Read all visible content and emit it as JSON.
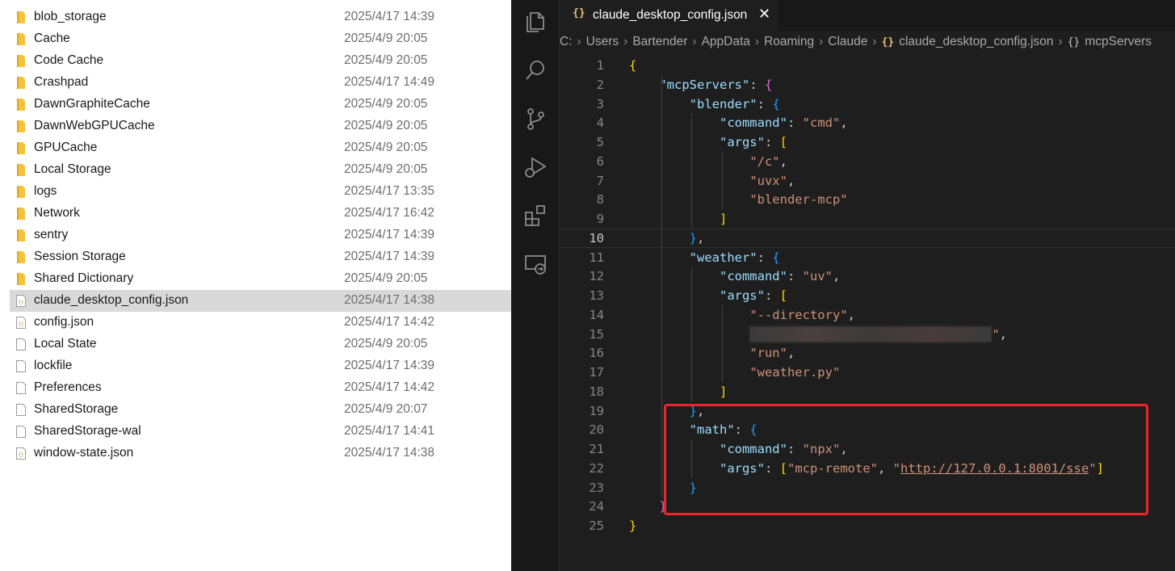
{
  "explorer": {
    "files": [
      {
        "name": "blob_storage",
        "date": "2025/4/17 14:39",
        "type": "folder"
      },
      {
        "name": "Cache",
        "date": "2025/4/9 20:05",
        "type": "folder"
      },
      {
        "name": "Code Cache",
        "date": "2025/4/9 20:05",
        "type": "folder"
      },
      {
        "name": "Crashpad",
        "date": "2025/4/17 14:49",
        "type": "folder"
      },
      {
        "name": "DawnGraphiteCache",
        "date": "2025/4/9 20:05",
        "type": "folder"
      },
      {
        "name": "DawnWebGPUCache",
        "date": "2025/4/9 20:05",
        "type": "folder"
      },
      {
        "name": "GPUCache",
        "date": "2025/4/9 20:05",
        "type": "folder"
      },
      {
        "name": "Local Storage",
        "date": "2025/4/9 20:05",
        "type": "folder"
      },
      {
        "name": "logs",
        "date": "2025/4/17 13:35",
        "type": "folder"
      },
      {
        "name": "Network",
        "date": "2025/4/17 16:42",
        "type": "folder"
      },
      {
        "name": "sentry",
        "date": "2025/4/17 14:39",
        "type": "folder"
      },
      {
        "name": "Session Storage",
        "date": "2025/4/17 14:39",
        "type": "folder"
      },
      {
        "name": "Shared Dictionary",
        "date": "2025/4/9 20:05",
        "type": "folder"
      },
      {
        "name": "claude_desktop_config.json",
        "date": "2025/4/17 14:38",
        "type": "json",
        "selected": true
      },
      {
        "name": "config.json",
        "date": "2025/4/17 14:42",
        "type": "json"
      },
      {
        "name": "Local State",
        "date": "2025/4/9 20:05",
        "type": "file"
      },
      {
        "name": "lockfile",
        "date": "2025/4/17 14:39",
        "type": "file"
      },
      {
        "name": "Preferences",
        "date": "2025/4/17 14:42",
        "type": "file"
      },
      {
        "name": "SharedStorage",
        "date": "2025/4/9 20:07",
        "type": "file"
      },
      {
        "name": "SharedStorage-wal",
        "date": "2025/4/17 14:41",
        "type": "file"
      },
      {
        "name": "window-state.json",
        "date": "2025/4/17 14:38",
        "type": "json"
      }
    ]
  },
  "editor": {
    "tab": {
      "icon_text": "{}",
      "label": "claude_desktop_config.json",
      "close": "✕"
    },
    "breadcrumb": [
      "C:",
      "Users",
      "Bartender",
      "AppData",
      "Roaming",
      "Claude"
    ],
    "breadcrumb_file": "claude_desktop_config.json",
    "breadcrumb_json_icon": "{}",
    "breadcrumb_symbol_icon": "{}",
    "breadcrumb_symbol": "mcpServers",
    "active_line": 10,
    "lines": [
      [
        [
          "b1",
          "{"
        ]
      ],
      [
        [
          "i",
          "    "
        ],
        [
          "k",
          "\"mcpServers\""
        ],
        [
          "p",
          ": "
        ],
        [
          "b2",
          "{"
        ]
      ],
      [
        [
          "i",
          "        "
        ],
        [
          "k",
          "\"blender\""
        ],
        [
          "p",
          ": "
        ],
        [
          "b3",
          "{"
        ]
      ],
      [
        [
          "i",
          "            "
        ],
        [
          "k",
          "\"command\""
        ],
        [
          "p",
          ": "
        ],
        [
          "s",
          "\"cmd\""
        ],
        [
          "p",
          ","
        ]
      ],
      [
        [
          "i",
          "            "
        ],
        [
          "k",
          "\"args\""
        ],
        [
          "p",
          ": "
        ],
        [
          "b1",
          "["
        ]
      ],
      [
        [
          "i",
          "                "
        ],
        [
          "s",
          "\"/c\""
        ],
        [
          "p",
          ","
        ]
      ],
      [
        [
          "i",
          "                "
        ],
        [
          "s",
          "\"uvx\""
        ],
        [
          "p",
          ","
        ]
      ],
      [
        [
          "i",
          "                "
        ],
        [
          "s",
          "\"blender-mcp\""
        ]
      ],
      [
        [
          "i",
          "            "
        ],
        [
          "b1",
          "]"
        ]
      ],
      [
        [
          "i",
          "        "
        ],
        [
          "b3",
          "}"
        ],
        [
          "p",
          ","
        ]
      ],
      [
        [
          "i",
          "        "
        ],
        [
          "k",
          "\"weather\""
        ],
        [
          "p",
          ": "
        ],
        [
          "b3",
          "{"
        ]
      ],
      [
        [
          "i",
          "            "
        ],
        [
          "k",
          "\"command\""
        ],
        [
          "p",
          ": "
        ],
        [
          "s",
          "\"uv\""
        ],
        [
          "p",
          ","
        ]
      ],
      [
        [
          "i",
          "            "
        ],
        [
          "k",
          "\"args\""
        ],
        [
          "p",
          ": "
        ],
        [
          "b1",
          "["
        ]
      ],
      [
        [
          "i",
          "                "
        ],
        [
          "s",
          "\"--directory\""
        ],
        [
          "p",
          ","
        ]
      ],
      [
        [
          "i",
          "                "
        ],
        [
          "blur",
          ""
        ],
        [
          "s",
          "\""
        ],
        [
          "p",
          ","
        ]
      ],
      [
        [
          "i",
          "                "
        ],
        [
          "s",
          "\"run\""
        ],
        [
          "p",
          ","
        ]
      ],
      [
        [
          "i",
          "                "
        ],
        [
          "s",
          "\"weather.py\""
        ]
      ],
      [
        [
          "i",
          "            "
        ],
        [
          "b1",
          "]"
        ]
      ],
      [
        [
          "i",
          "        "
        ],
        [
          "b3",
          "}"
        ],
        [
          "p",
          ","
        ]
      ],
      [
        [
          "i",
          "        "
        ],
        [
          "k",
          "\"math\""
        ],
        [
          "p",
          ": "
        ],
        [
          "b3",
          "{"
        ]
      ],
      [
        [
          "i",
          "            "
        ],
        [
          "k",
          "\"command\""
        ],
        [
          "p",
          ": "
        ],
        [
          "s",
          "\"npx\""
        ],
        [
          "p",
          ","
        ]
      ],
      [
        [
          "i",
          "            "
        ],
        [
          "k",
          "\"args\""
        ],
        [
          "p",
          ": "
        ],
        [
          "b1",
          "["
        ],
        [
          "s",
          "\"mcp-remote\""
        ],
        [
          "p",
          ", "
        ],
        [
          "s",
          "\""
        ],
        [
          "url",
          "http://127.0.0.1:8001/sse"
        ],
        [
          "s",
          "\""
        ],
        [
          "b1",
          "]"
        ]
      ],
      [
        [
          "i",
          "        "
        ],
        [
          "b3",
          "}"
        ]
      ],
      [
        [
          "i",
          "    "
        ],
        [
          "b2",
          "}"
        ]
      ],
      [
        [
          "b1",
          "}"
        ]
      ]
    ]
  },
  "icons": [
    "explorer-icon",
    "search-icon",
    "source-control-icon",
    "run-debug-icon",
    "extensions-icon",
    "remote-explorer-icon"
  ],
  "colors": {
    "highlight_box": "#e8262b",
    "folder": "#f3c33d",
    "editor_bg": "#1e1e1e"
  }
}
